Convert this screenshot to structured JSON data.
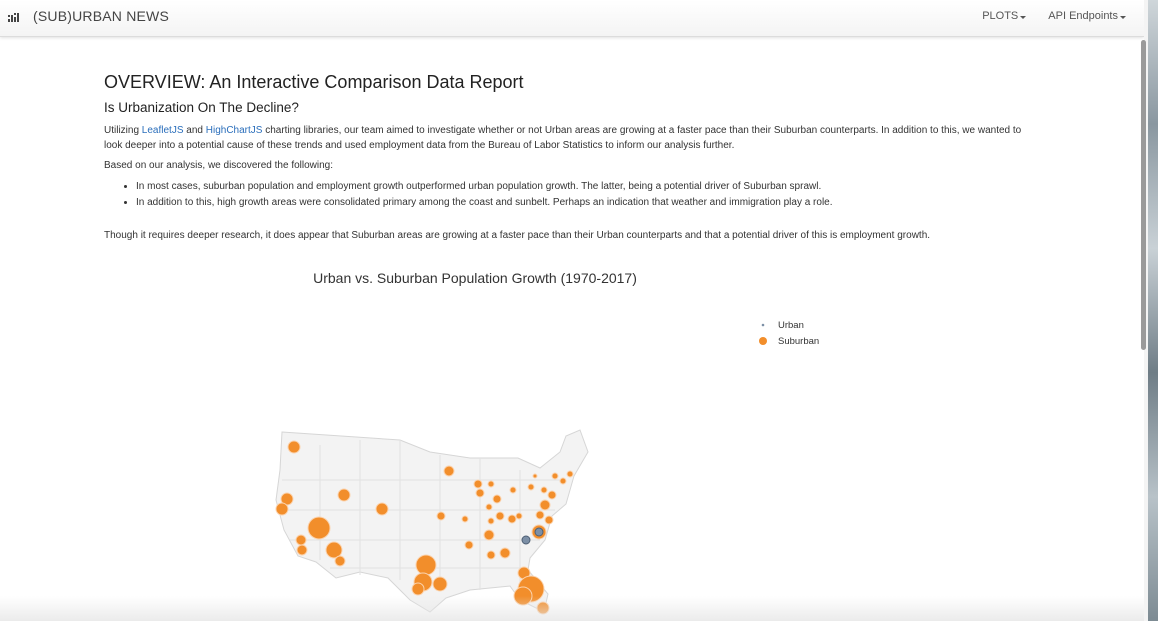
{
  "navbar": {
    "brand": "(SUB)URBAN NEWS",
    "brand_icon": "bar-chart-icon",
    "menu": [
      {
        "label": "PLOTS"
      },
      {
        "label": "API Endpoints"
      }
    ]
  },
  "report": {
    "title": "OVERVIEW: An Interactive Comparison Data Report",
    "subtitle": "Is Urbanization On The Decline?",
    "intro": {
      "prefix": "Utilizing ",
      "link1": "LeafletJS",
      "and": " and ",
      "link2": "HighChartJS",
      "suffix": " charting libraries, our team aimed to investigate whether or not Urban areas are growing at a faster pace than their Suburban counterparts. In addition to this, we wanted to look deeper into a potential cause of these trends and used employment data from the Bureau of Labor Statistics to inform our analysis further."
    },
    "based_on": "Based on our analysis, we discovered the following:",
    "findings": [
      "In most cases, suburban population and employment growth outperformed urban population growth. The latter, being a potential driver of Suburban sprawl.",
      "In addition to this, high growth areas were consolidated primary among the coast and sunbelt. Perhaps an indication that weather and immigration play a role."
    ],
    "conclusion": "Though it requires deeper research, it does appear that Suburban areas are growing at a faster pace than their Urban counterparts and that a potential driver of this is employment growth."
  },
  "colors": {
    "suburban": "#f28e2b",
    "urban": "#7c8fa6",
    "link": "#2a6ebb"
  },
  "chart": {
    "title": "Urban vs. Suburban Population Growth (1970-2017)",
    "legend": [
      {
        "name": "Urban",
        "marker": "small-dot"
      },
      {
        "name": "Suburban",
        "marker": "orange-circle"
      }
    ]
  }
}
